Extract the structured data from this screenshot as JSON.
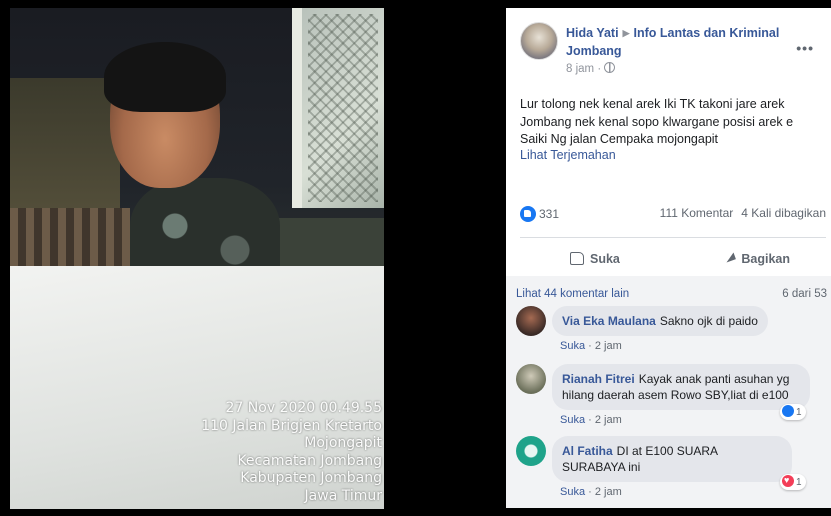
{
  "photo": {
    "stamp_lines": [
      "27 Nov 2020 00.49.55",
      "110 Jalan Brigjen Kretarto",
      "Mojongapit",
      "Kecamatan Jombang",
      "Kabupaten Jombang",
      "Jawa Timur"
    ]
  },
  "post": {
    "author": "Hida Yati",
    "group": "Info Lantas dan Kriminal Jombang",
    "time": "8 jam",
    "text": "Lur tolong nek kenal arek Iki TK takoni jare arek Jombang nek kenal sopo klwargane posisi arek e Saiki Ng jalan Cempaka mojongapit",
    "translate_label": "Lihat Terjemahan",
    "reaction_count": "331",
    "comments_count": "111 Komentar",
    "shares_count": "4 Kali dibagikan",
    "like_label": "Suka",
    "share_label": "Bagikan"
  },
  "comments_section": {
    "more_label": "Lihat 44 komentar lain",
    "count_label": "6 dari 53",
    "items": [
      {
        "name": "Via Eka Maulana",
        "text": "Sakno ojk di paido",
        "like_label": "Suka",
        "time": "2 jam",
        "reaction": "",
        "avatar_color": "#3a2a26"
      },
      {
        "name": "Rianah Fitrei",
        "text": "Kayak anak panti asuhan yg hilang daerah asem Rowo SBY,liat di e100",
        "like_label": "Suka",
        "time": "2 jam",
        "reaction": "1",
        "avatar_color": "#6b6f5a"
      },
      {
        "name": "Al Fatiha",
        "text": "DI at E100 SUARA SURABAYA ini",
        "like_label": "Suka",
        "time": "2 jam",
        "reaction": "1",
        "avatar_color": "#1fa38a"
      }
    ]
  },
  "colors": {
    "link": "#385898",
    "like_blue": "#1877f2",
    "love_red": "#f33e58"
  }
}
